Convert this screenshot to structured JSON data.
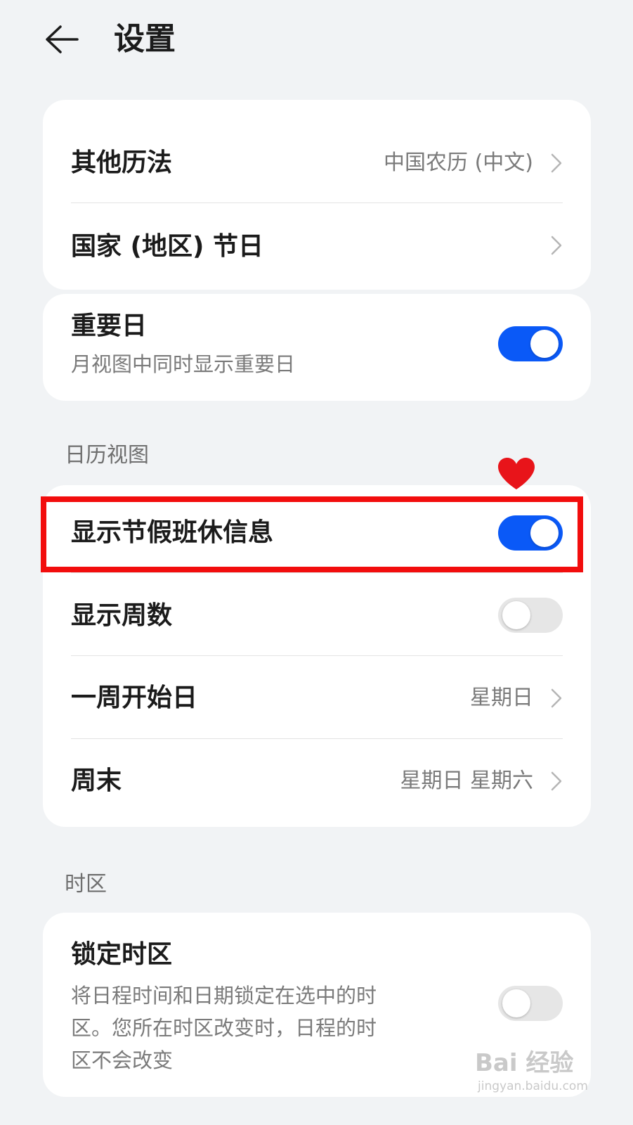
{
  "header": {
    "title": "设置"
  },
  "card1": {
    "rows": [
      {
        "title": "其他历法",
        "value": "中国农历 (中文)"
      },
      {
        "title": "国家 (地区) 节日"
      }
    ]
  },
  "card2": {
    "title": "重要日",
    "subtitle": "月视图中同时显示重要日",
    "toggle": "on"
  },
  "section_calendar_view": {
    "label": "日历视图",
    "rows": [
      {
        "title": "显示节假班休信息",
        "toggle": "on"
      },
      {
        "title": "显示周数",
        "toggle": "off"
      },
      {
        "title": "一周开始日",
        "value": "星期日"
      },
      {
        "title": "周末",
        "value": "星期日 星期六"
      }
    ]
  },
  "section_timezone": {
    "label": "时区",
    "title": "锁定时区",
    "subtitle_lines": [
      "将日程时间和日期锁定在选中的时",
      "区。您所在时区改变时，日程的时",
      "区不会改变"
    ],
    "toggle": "off"
  },
  "annotation": {
    "highlight_color": "#f20d0d",
    "heart_color": "#e8141a"
  },
  "watermark": {
    "brand": "Bai 经验",
    "url": "jingyan.baidu.com"
  },
  "colors": {
    "accent": "#0a59f7",
    "background": "#f1f3f5",
    "card": "#ffffff"
  }
}
